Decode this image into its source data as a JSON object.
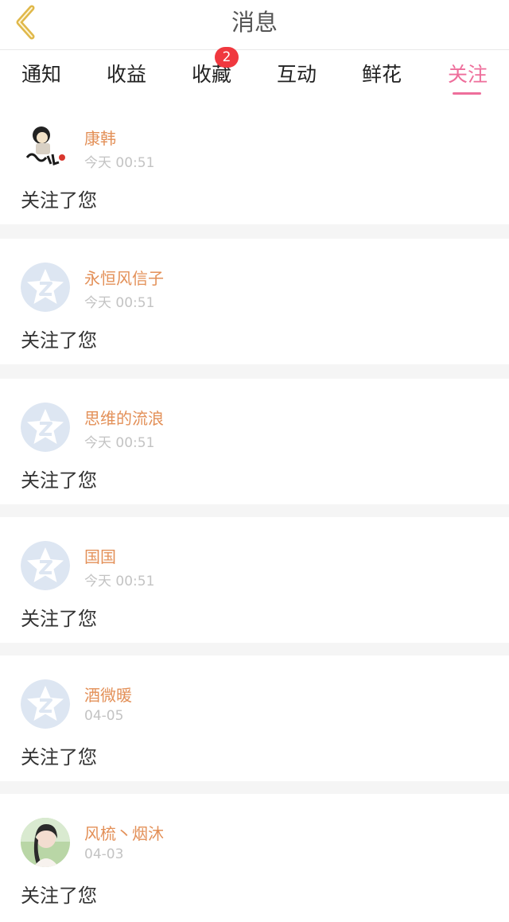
{
  "header": {
    "title": "消息",
    "back_icon": "chevron-left-icon",
    "back_color": "#e0b84a"
  },
  "tabs": [
    {
      "label": "通知"
    },
    {
      "label": "收益"
    },
    {
      "label": "收藏",
      "badge": "2"
    },
    {
      "label": "互动"
    },
    {
      "label": "鲜花"
    },
    {
      "label": "关注",
      "active": true
    }
  ],
  "colors": {
    "accent": "#ee6e9b",
    "username": "#e39058",
    "badge": "#f0383f"
  },
  "notifications": [
    {
      "user": "康韩",
      "time": "今天 00:51",
      "message": "关注了您",
      "avatar": "cartoon-avatar"
    },
    {
      "user": "永恒风信子",
      "time": "今天 00:51",
      "message": "关注了您",
      "avatar": "default-star-avatar"
    },
    {
      "user": "思维的流浪",
      "time": "今天 00:51",
      "message": "关注了您",
      "avatar": "default-star-avatar"
    },
    {
      "user": "国国",
      "time": "今天 00:51",
      "message": "关注了您",
      "avatar": "default-star-avatar"
    },
    {
      "user": "酒微暖",
      "time": "04-05",
      "message": "关注了您",
      "avatar": "default-star-avatar"
    },
    {
      "user": "风梳丶烟沐",
      "time": "04-03",
      "message": "关注了您",
      "avatar": "photo-avatar"
    }
  ]
}
